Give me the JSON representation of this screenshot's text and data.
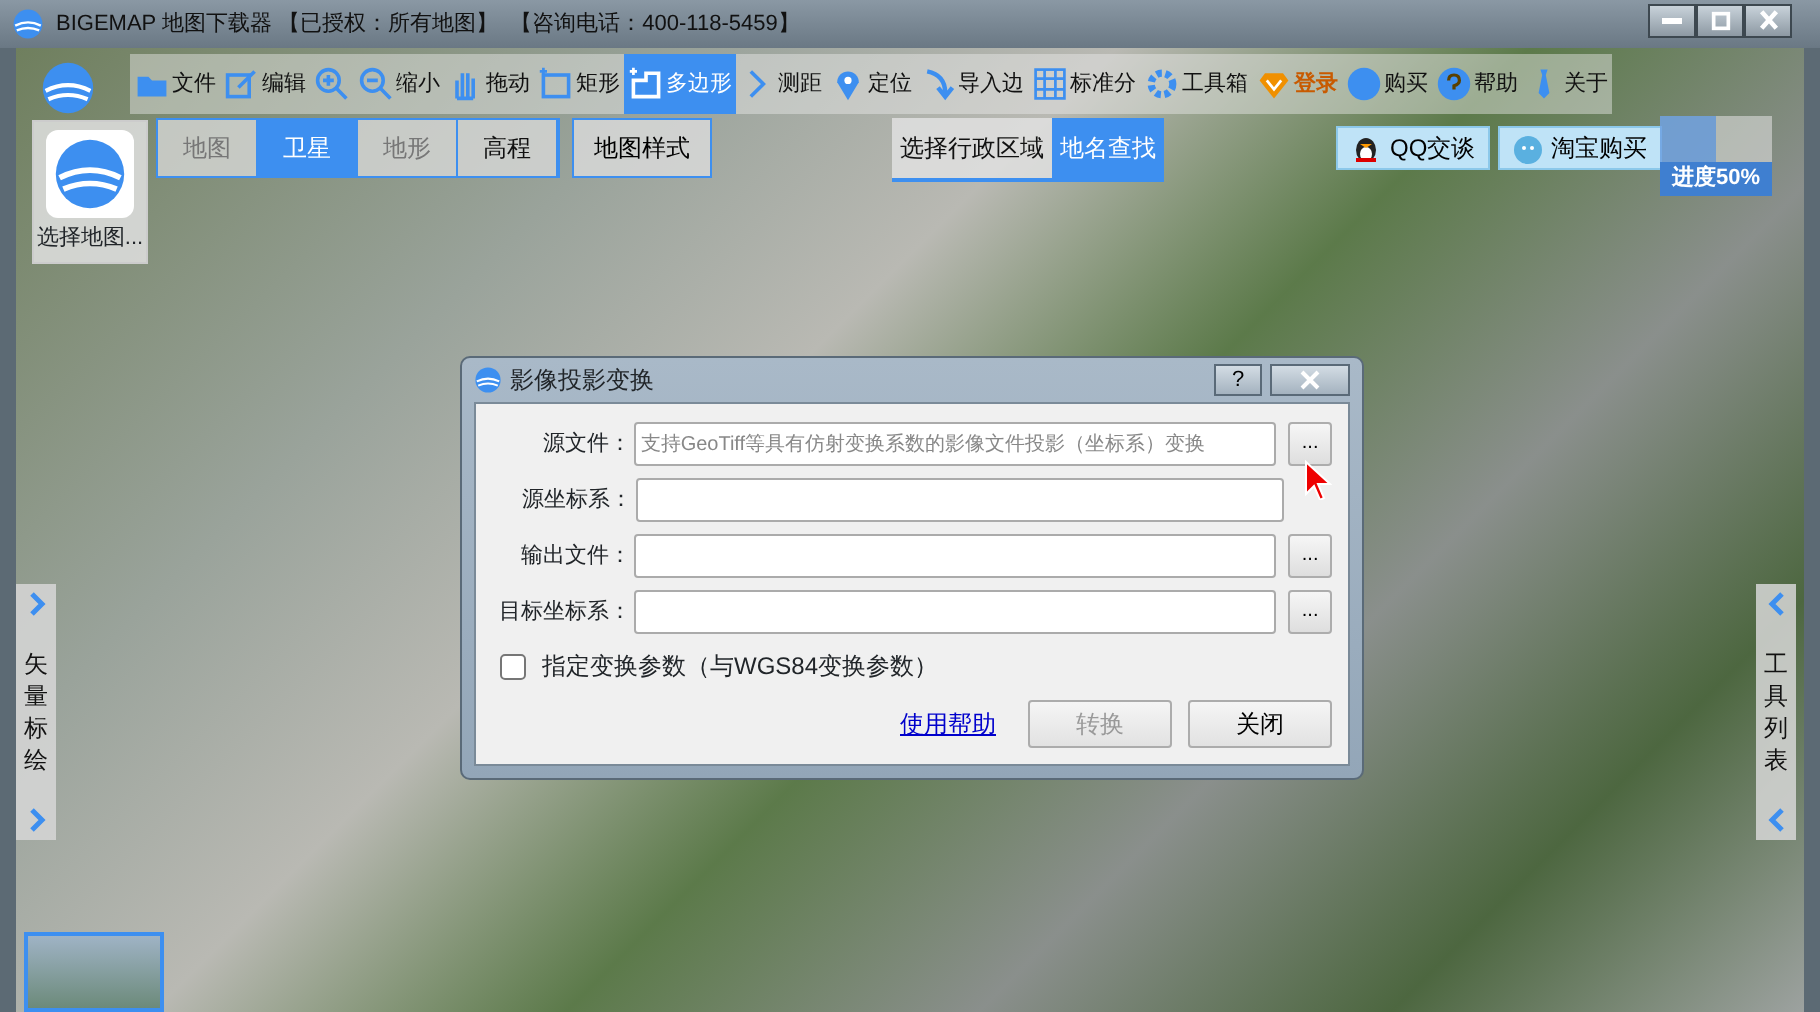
{
  "window": {
    "title": "BIGEMAP 地图下载器 【已授权：所有地图】  【咨询电话：400-118-5459】"
  },
  "toolbar": [
    {
      "label": "文件",
      "selected": false
    },
    {
      "label": "编辑",
      "selected": false
    },
    {
      "selected": false
    },
    {
      "label": "缩小",
      "selected": false
    },
    {
      "label": "拖动",
      "selected": false
    },
    {
      "label": "矩形",
      "selected": false
    },
    {
      "label": "多边形",
      "selected": true
    },
    {
      "label": "测距",
      "selected": false
    },
    {
      "label": "定位",
      "selected": false
    },
    {
      "label": "导入边",
      "selected": false
    },
    {
      "label": "标准分",
      "selected": false
    },
    {
      "label": "工具箱",
      "selected": false
    },
    {
      "label": "登录",
      "selected": false
    },
    {
      "label": "购买",
      "selected": false
    },
    {
      "label": "帮助",
      "selected": false
    },
    {
      "label": "关于",
      "selected": false
    }
  ],
  "map_selector": {
    "label": "选择地图..."
  },
  "map_types": [
    {
      "label": "地图",
      "selected": false,
      "disabled": true
    },
    {
      "label": "卫星",
      "selected": true,
      "disabled": false
    },
    {
      "label": "地形",
      "selected": false,
      "disabled": true
    },
    {
      "label": "高程",
      "selected": false,
      "disabled": false
    }
  ],
  "map_style": "地图样式",
  "region_tabs": [
    {
      "label": "选择行政区域",
      "selected": false
    },
    {
      "label": "地名查找",
      "selected": true
    }
  ],
  "contact_buttons": [
    "QQ交谈",
    "淘宝购买"
  ],
  "progress": {
    "label": "进度50%",
    "level": 0.5
  },
  "left_panel": {
    "label": "矢量标绘"
  },
  "right_panel": {
    "label": "工具列表"
  },
  "dialog": {
    "title": "影像投影变换",
    "fields": [
      {
        "label": "源文件：",
        "placeholder": "支持GeoTiff等具有仿射变换系数的影像文件投影（坐标系）变换",
        "browse": "..."
      },
      {
        "label": "源坐标系："
      },
      {
        "label": "输出文件：",
        "browse": "..."
      },
      {
        "label": "目标坐标系：",
        "browse": "..."
      }
    ],
    "help_button": "?",
    "checkbox": {
      "label": "指定变换参数（与WGS84变换参数）",
      "checked": false
    },
    "help_link": "使用帮助",
    "buttons": [
      {
        "label": "转换",
        "disabled": true
      },
      {
        "label": "关闭",
        "disabled": false
      }
    ]
  }
}
